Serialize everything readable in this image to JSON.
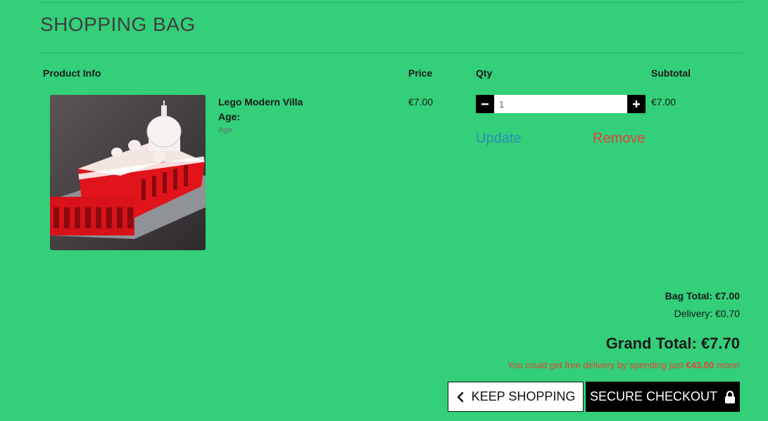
{
  "page": {
    "title": "SHOPPING BAG"
  },
  "table": {
    "headers": {
      "product": "Product Info",
      "price": "Price",
      "qty": "Qty",
      "subtotal": "Subtotal"
    }
  },
  "item": {
    "name": "Lego Modern Villa",
    "age_label": "Age:",
    "age_value": "Age",
    "price": "€7.00",
    "quantity": "1",
    "subtotal": "€7.00",
    "update_label": "Update",
    "remove_label": "Remove"
  },
  "totals": {
    "bag_total": "Bag Total: €7.00",
    "delivery": "Delivery: €0.70",
    "grand_total": "Grand Total: €7.70",
    "free_delivery_prefix": "You could get free delivery by spending just ",
    "free_delivery_amount": "€43.00",
    "free_delivery_suffix": " more!"
  },
  "buttons": {
    "keep_shopping": "KEEP SHOPPING",
    "secure_checkout": "SECURE CHECKOUT"
  },
  "icons": {
    "minus": "minus-icon",
    "plus": "plus-icon",
    "back": "chevron-left-icon",
    "lock": "lock-icon"
  },
  "colors": {
    "background": "#33cf79",
    "update_link": "#2a8fb8",
    "remove_link": "#e0433c",
    "button_dark": "#000000"
  }
}
